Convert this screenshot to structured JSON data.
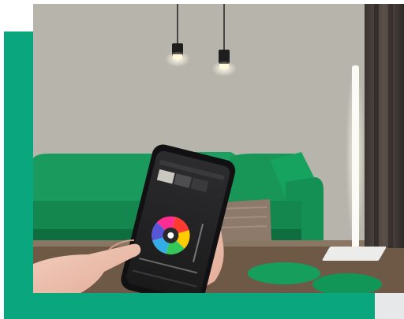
{
  "scene": {
    "colors": {
      "brand_teal": "#0aa77f",
      "wall": "#b6b3ab",
      "sofa_green": "#1d9c5e",
      "floor": "#6e5a47",
      "lamp_glow": "#fffbe8"
    },
    "icons": {
      "pendant_lights": "pendant-lamp-icon",
      "floor_lamp": "floor-lamp-icon",
      "color_wheel": "color-wheel-icon"
    }
  }
}
